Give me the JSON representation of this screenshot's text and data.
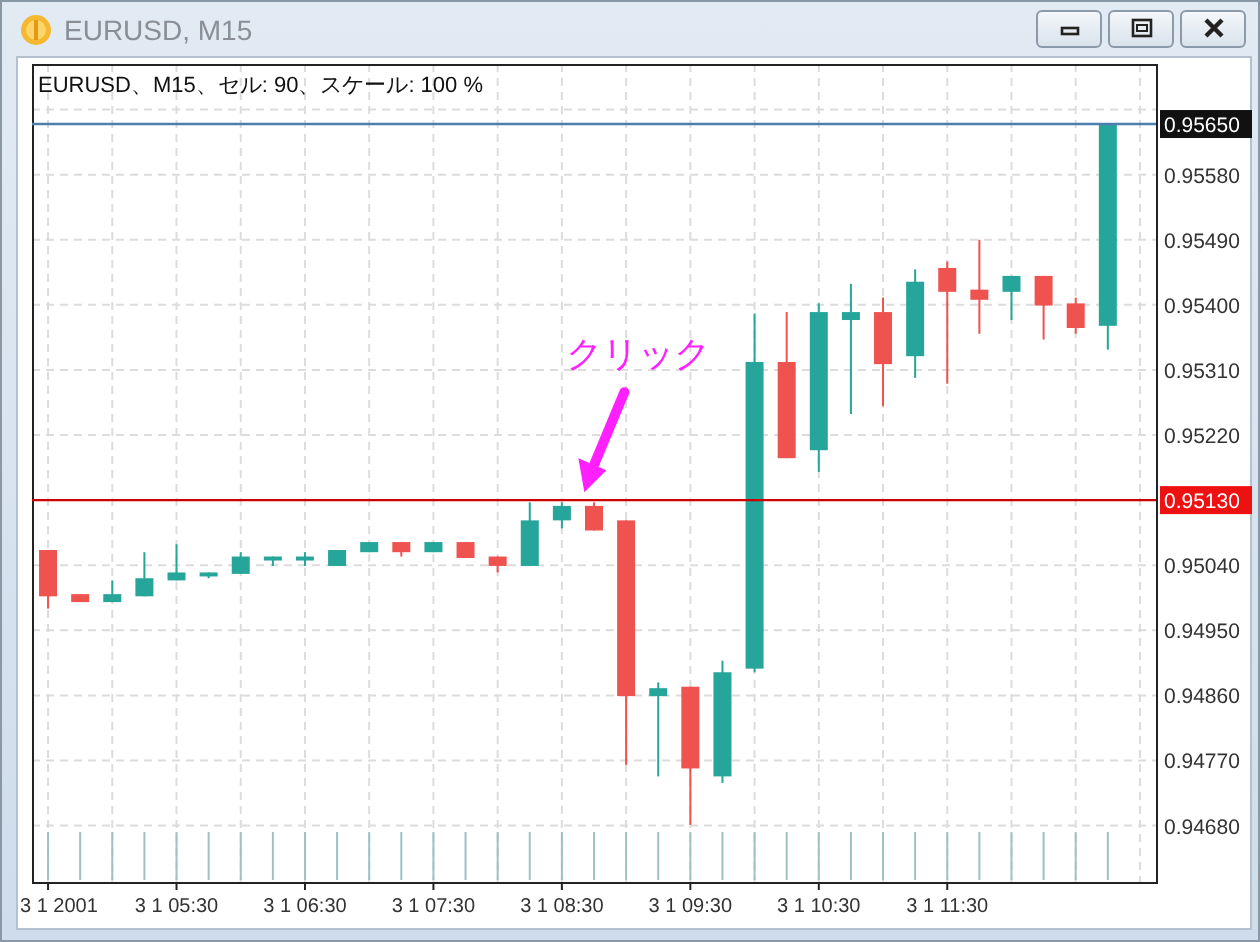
{
  "window": {
    "title": "EURUSD, M15"
  },
  "chart": {
    "header": "EURUSD、M15、セル: 90、スケール: 100 %",
    "chart_data": {
      "type": "candlestick",
      "grid": true,
      "ylim": [
        0.94602,
        0.95733
      ],
      "categories": [
        "3 1 2001",
        null,
        null,
        null,
        "3 1 05:30",
        null,
        null,
        null,
        "3 1 06:30",
        null,
        null,
        null,
        "3 1 07:30",
        null,
        null,
        null,
        "3 1 08:30",
        null,
        null,
        null,
        "3 1 09:30",
        null,
        null,
        null,
        "3 1 10:30",
        null,
        null,
        null,
        "3 1 11:30",
        null,
        null,
        null,
        null,
        null,
        null
      ],
      "yticks": [
        {
          "value": 0.9558,
          "label": "0.95580"
        },
        {
          "value": 0.9549,
          "label": "0.95490"
        },
        {
          "value": 0.954,
          "label": "0.95400"
        },
        {
          "value": 0.9531,
          "label": "0.95310"
        },
        {
          "value": 0.9522,
          "label": "0.95220"
        },
        {
          "value": 0.9504,
          "label": "0.95040"
        },
        {
          "value": 0.9495,
          "label": "0.94950"
        },
        {
          "value": 0.9486,
          "label": "0.94860"
        },
        {
          "value": 0.9477,
          "label": "0.94770"
        },
        {
          "value": 0.9468,
          "label": "0.94680"
        }
      ],
      "ohlc": [
        [
          0.95061,
          0.95061,
          0.9498,
          0.94997
        ],
        [
          0.95,
          0.95,
          0.94989,
          0.94989
        ],
        [
          0.94989,
          0.95019,
          0.94989,
          0.95
        ],
        [
          0.94997,
          0.95058,
          0.94997,
          0.95022
        ],
        [
          0.95019,
          0.95069,
          0.95019,
          0.9503
        ],
        [
          0.95028,
          0.9503,
          0.95022,
          0.9503
        ],
        [
          0.95028,
          0.95058,
          0.95028,
          0.95052
        ],
        [
          0.9505,
          0.95052,
          0.95039,
          0.95052
        ],
        [
          0.9505,
          0.95058,
          0.95039,
          0.95052
        ],
        [
          0.95039,
          0.95061,
          0.95039,
          0.95061
        ],
        [
          0.95058,
          0.95072,
          0.95058,
          0.95072
        ],
        [
          0.95072,
          0.95072,
          0.95052,
          0.95058
        ],
        [
          0.95058,
          0.95072,
          0.95058,
          0.95072
        ],
        [
          0.95072,
          0.95072,
          0.9505,
          0.9505
        ],
        [
          0.95052,
          0.95052,
          0.9503,
          0.95039
        ],
        [
          0.95039,
          0.95127,
          0.95039,
          0.95102
        ],
        [
          0.95102,
          0.95127,
          0.95091,
          0.95122
        ],
        [
          0.95122,
          0.95127,
          0.95088,
          0.95088
        ],
        [
          0.95102,
          0.95102,
          0.94764,
          0.94859
        ],
        [
          0.94859,
          0.94878,
          0.94748,
          0.9487
        ],
        [
          0.94872,
          0.94872,
          0.94681,
          0.94759
        ],
        [
          0.94748,
          0.94908,
          0.94739,
          0.94892
        ],
        [
          0.94897,
          0.95388,
          0.94892,
          0.95321
        ],
        [
          0.95321,
          0.9539,
          0.95188,
          0.95188
        ],
        [
          0.95199,
          0.95402,
          0.95169,
          0.9539
        ],
        [
          0.95379,
          0.95429,
          0.95249,
          0.9539
        ],
        [
          0.9539,
          0.9541,
          0.9526,
          0.95318
        ],
        [
          0.95329,
          0.95449,
          0.95299,
          0.95432
        ],
        [
          0.95451,
          0.9546,
          0.95291,
          0.95418
        ],
        [
          0.95421,
          0.9549,
          0.9536,
          0.95407
        ],
        [
          0.95418,
          0.9544,
          0.95379,
          0.9544
        ],
        [
          0.9544,
          0.9544,
          0.95352,
          0.95399
        ],
        [
          0.95402,
          0.9541,
          0.9536,
          0.95368
        ],
        [
          0.95371,
          0.9565,
          0.95338,
          0.9565
        ],
        null
      ],
      "ref_lines": [
        {
          "axis": "y",
          "value": 0.9565,
          "label": "0.95650",
          "color": "#4f7fae"
        },
        {
          "axis": "y",
          "value": 0.9513,
          "label": "0.95130",
          "color": "#cc0000"
        }
      ],
      "annotations": [
        "クリック"
      ]
    }
  }
}
